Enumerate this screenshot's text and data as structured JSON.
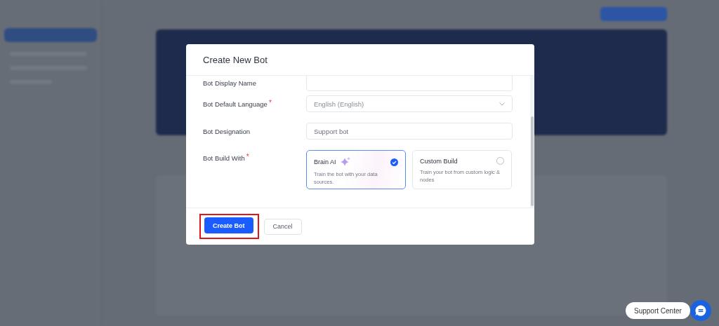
{
  "modal": {
    "title": "Create New Bot",
    "fields": [
      {
        "kind": "text",
        "label": "Bot Display Name"
      },
      {
        "kind": "select",
        "label": "Bot Default Language",
        "required_mark": "*",
        "value": "English (English)"
      },
      {
        "kind": "text",
        "label": "Bot Designation",
        "value": "Support bot"
      },
      {
        "kind": "options",
        "label": "Bot Build With",
        "required_mark": "*",
        "options": [
          {
            "title": "Brain AI",
            "description": "Train the bot with your data sources.",
            "selected": true
          },
          {
            "title": "Custom Build",
            "description": "Train your bot from custom logic & nodes",
            "selected": false
          }
        ]
      }
    ],
    "buttons": [
      {
        "kind": "primary",
        "label": "Create Bot",
        "highlighted": true
      },
      {
        "kind": "secondary",
        "label": "Cancel",
        "highlighted": false
      }
    ]
  },
  "support": {
    "label": "Support Center"
  }
}
